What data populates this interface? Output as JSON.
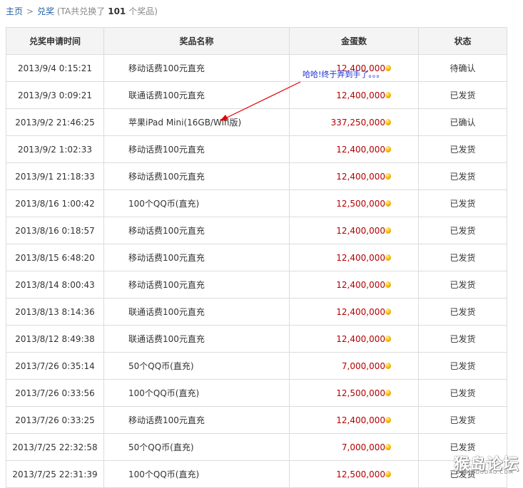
{
  "breadcrumb": {
    "home": "主页",
    "separator": ">",
    "current": "兑奖",
    "count_prefix": "(TA共兑换了",
    "count": "101",
    "count_suffix": "个奖品)"
  },
  "table": {
    "headers": [
      "兑奖申请时间",
      "奖品名称",
      "金蛋数",
      "状态"
    ],
    "rows": [
      {
        "time": "2013/9/4 0:15:21",
        "name": "移动话费100元直充",
        "amount": "12,400,000",
        "status": "待确认"
      },
      {
        "time": "2013/9/3 0:09:21",
        "name": "联通话费100元直充",
        "amount": "12,400,000",
        "status": "已发货"
      },
      {
        "time": "2013/9/2 21:46:25",
        "name": "苹果iPad Mini(16GB/Wifi版)",
        "amount": "337,250,000",
        "status": "已确认"
      },
      {
        "time": "2013/9/2 1:02:33",
        "name": "移动话费100元直充",
        "amount": "12,400,000",
        "status": "已发货"
      },
      {
        "time": "2013/9/1 21:18:33",
        "name": "移动话费100元直充",
        "amount": "12,400,000",
        "status": "已发货"
      },
      {
        "time": "2013/8/16 1:00:42",
        "name": "100个QQ币(直充)",
        "amount": "12,500,000",
        "status": "已发货"
      },
      {
        "time": "2013/8/16 0:18:57",
        "name": "移动话费100元直充",
        "amount": "12,400,000",
        "status": "已发货"
      },
      {
        "time": "2013/8/15 6:48:20",
        "name": "移动话费100元直充",
        "amount": "12,400,000",
        "status": "已发货"
      },
      {
        "time": "2013/8/14 8:00:43",
        "name": "移动话费100元直充",
        "amount": "12,400,000",
        "status": "已发货"
      },
      {
        "time": "2013/8/13 8:14:36",
        "name": "联通话费100元直充",
        "amount": "12,400,000",
        "status": "已发货"
      },
      {
        "time": "2013/8/12 8:49:38",
        "name": "联通话费100元直充",
        "amount": "12,400,000",
        "status": "已发货"
      },
      {
        "time": "2013/7/26 0:35:14",
        "name": "50个QQ币(直充)",
        "amount": "7,000,000",
        "status": "已发货"
      },
      {
        "time": "2013/7/26 0:33:56",
        "name": "100个QQ币(直充)",
        "amount": "12,500,000",
        "status": "已发货"
      },
      {
        "time": "2013/7/26 0:33:25",
        "name": "移动话费100元直充",
        "amount": "12,400,000",
        "status": "已发货"
      },
      {
        "time": "2013/7/25 22:32:58",
        "name": "50个QQ币(直充)",
        "amount": "7,000,000",
        "status": "已发货"
      },
      {
        "time": "2013/7/25 22:31:39",
        "name": "100个QQ币(直充)",
        "amount": "12,500,000",
        "status": "已发货"
      }
    ]
  },
  "annotation": {
    "text": "哈哈!终于弄到手了。。。",
    "color": "#1a2fd6"
  },
  "watermark": {
    "text": "猴岛论坛",
    "subtext": "BBS.HOUDAO.COM"
  },
  "colors": {
    "link": "#1f5fa8",
    "amount": "#b40000",
    "header_bg": "#f4f4f4",
    "border": "#dcdcdc",
    "arrow": "#e00000",
    "egg": "#f6b800"
  },
  "icons": {
    "egg": "gold-egg-icon",
    "arrow": "annotation-arrow"
  }
}
